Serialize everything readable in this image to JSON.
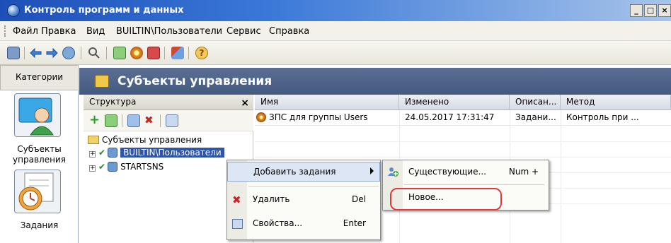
{
  "window": {
    "title": "Контроль программ и данных",
    "controls": [
      "_",
      "□",
      "×"
    ]
  },
  "menubar": {
    "items": [
      "Файл",
      "Правка",
      "Вид",
      "BUILTIN\\Пользователи",
      "Сервис",
      "Справка"
    ]
  },
  "left_panel": {
    "tab_label": "Категории",
    "categories": [
      {
        "label": "Субъекты управления",
        "icon": "user-subjects-icon"
      },
      {
        "label": "Задания",
        "icon": "tasks-clock-icon"
      }
    ]
  },
  "header": {
    "title": "Субъекты управления"
  },
  "structure_pane": {
    "title": "Структура",
    "close_glyph": "×",
    "tree": {
      "root": "Субъекты управления",
      "children": [
        "BUILTIN\\Пользователи",
        "STARTSNS"
      ]
    }
  },
  "grid": {
    "columns": [
      "Имя",
      "Изменено",
      "Описан...",
      "Метод"
    ],
    "rows": [
      {
        "name": "ЗПС для группы Users",
        "modified": "24.05.2017 17:31:47",
        "description": "Задани...",
        "method": "Контроль при ..."
      }
    ]
  },
  "context_menu": {
    "items": [
      {
        "label": "Добавить задания",
        "shortcut": "",
        "submenu": true
      },
      {
        "label": "Удалить",
        "shortcut": "Del"
      },
      {
        "label": "Свойства...",
        "shortcut": "Enter"
      }
    ]
  },
  "submenu": {
    "items": [
      {
        "label": "Существующие...",
        "shortcut": "Num +"
      },
      {
        "label": "Новое...",
        "shortcut": ""
      }
    ]
  }
}
